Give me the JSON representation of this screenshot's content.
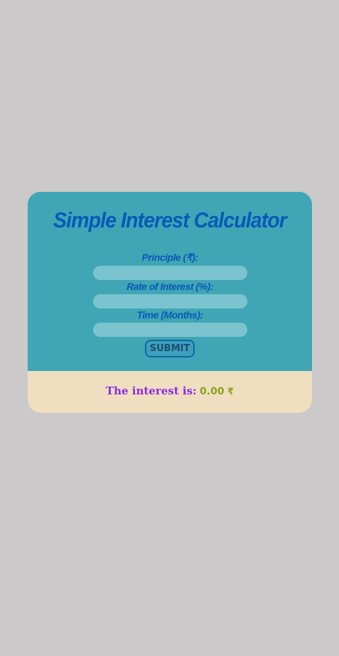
{
  "calculator": {
    "title": "Simple Interest Calculator",
    "principle_label": "Principle (₹):",
    "principle_value": "",
    "rate_label": "Rate of Interest (%):",
    "rate_value": "",
    "time_label": "Time (Months):",
    "time_value": "",
    "submit_label": "SUBMIT"
  },
  "result": {
    "label": "The interest is:",
    "value": "0.00",
    "currency_symbol": "₹"
  },
  "colors": {
    "page_background": "#cbc9ca",
    "card_background": "#40a6b5",
    "input_background": "#7bc4cf",
    "title_color": "#0a59b8",
    "result_background": "#f0dec1",
    "result_label_color": "#8a2be2",
    "result_value_color": "#8aa418"
  }
}
